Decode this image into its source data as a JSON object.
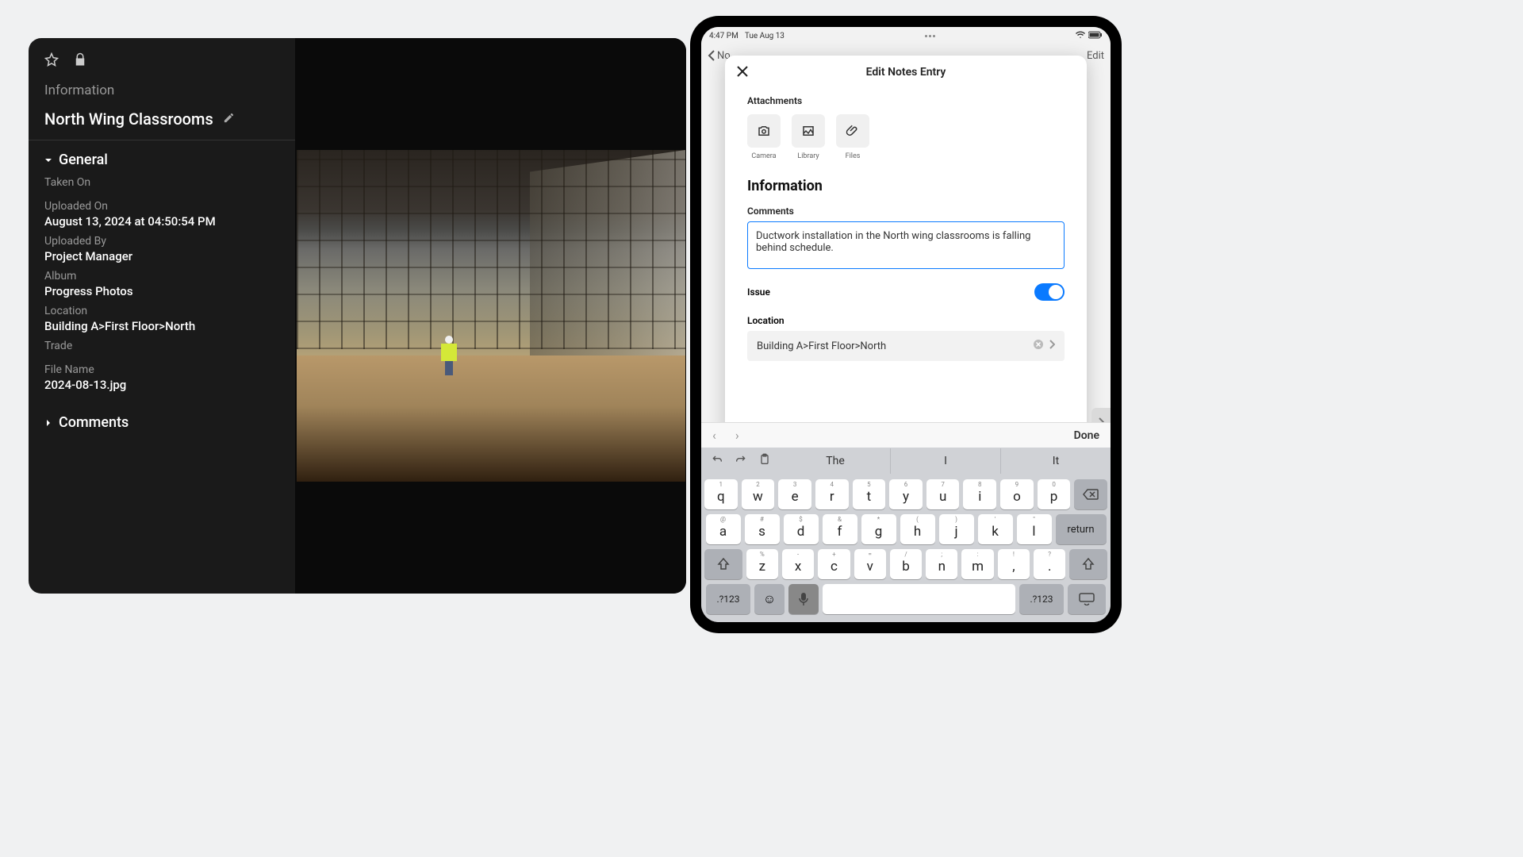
{
  "desktop": {
    "info_heading": "Information",
    "title": "North Wing Classrooms",
    "sections": {
      "general": {
        "label": "General",
        "taken_on": {
          "label": "Taken On",
          "value": ""
        },
        "uploaded_on": {
          "label": "Uploaded On",
          "value": "August 13, 2024 at 04:50:54 PM"
        },
        "uploaded_by": {
          "label": "Uploaded By",
          "value": "Project Manager"
        },
        "album": {
          "label": "Album",
          "value": "Progress Photos"
        },
        "location": {
          "label": "Location",
          "value": "Building A>First Floor>North"
        },
        "trade": {
          "label": "Trade",
          "value": ""
        },
        "file_name": {
          "label": "File Name",
          "value": "2024-08-13.jpg"
        }
      },
      "comments": {
        "label": "Comments"
      }
    }
  },
  "ipad": {
    "status": {
      "time": "4:47 PM",
      "date": "Tue Aug 13"
    },
    "nav": {
      "back": "No",
      "back_rest": "t",
      "edit": "Edit"
    },
    "modal": {
      "title": "Edit Notes Entry",
      "attachments_label": "Attachments",
      "attach": {
        "camera": "Camera",
        "library": "Library",
        "files": "Files"
      },
      "info_heading": "Information",
      "comments_label": "Comments",
      "comments_value": "Ductwork installation in the North wing classrooms is falling behind schedule.",
      "issue_label": "Issue",
      "issue_on": true,
      "location_label": "Location",
      "location_value": "Building A>First Floor>North"
    },
    "keyboard": {
      "done": "Done",
      "suggestions": [
        "The",
        "I",
        "It"
      ],
      "row1": [
        {
          "h": "1",
          "m": "q"
        },
        {
          "h": "2",
          "m": "w"
        },
        {
          "h": "3",
          "m": "e"
        },
        {
          "h": "4",
          "m": "r"
        },
        {
          "h": "5",
          "m": "t"
        },
        {
          "h": "6",
          "m": "y"
        },
        {
          "h": "7",
          "m": "u"
        },
        {
          "h": "8",
          "m": "i"
        },
        {
          "h": "9",
          "m": "o"
        },
        {
          "h": "0",
          "m": "p"
        }
      ],
      "row2": [
        {
          "h": "@",
          "m": "a"
        },
        {
          "h": "#",
          "m": "s"
        },
        {
          "h": "$",
          "m": "d"
        },
        {
          "h": "&",
          "m": "f"
        },
        {
          "h": "*",
          "m": "g"
        },
        {
          "h": "(",
          "m": "h"
        },
        {
          "h": ")",
          "m": "j"
        },
        {
          "h": "'",
          "m": "k"
        },
        {
          "h": "\"",
          "m": "l"
        }
      ],
      "row3": [
        {
          "h": "%",
          "m": "z"
        },
        {
          "h": "-",
          "m": "x"
        },
        {
          "h": "+",
          "m": "c"
        },
        {
          "h": "=",
          "m": "v"
        },
        {
          "h": "/",
          "m": "b"
        },
        {
          "h": ";",
          "m": "n"
        },
        {
          "h": ":",
          "m": "m"
        },
        {
          "h": "!",
          "m": ","
        },
        {
          "h": "?",
          "m": "."
        }
      ],
      "mode": ".?123",
      "return": "return"
    }
  }
}
